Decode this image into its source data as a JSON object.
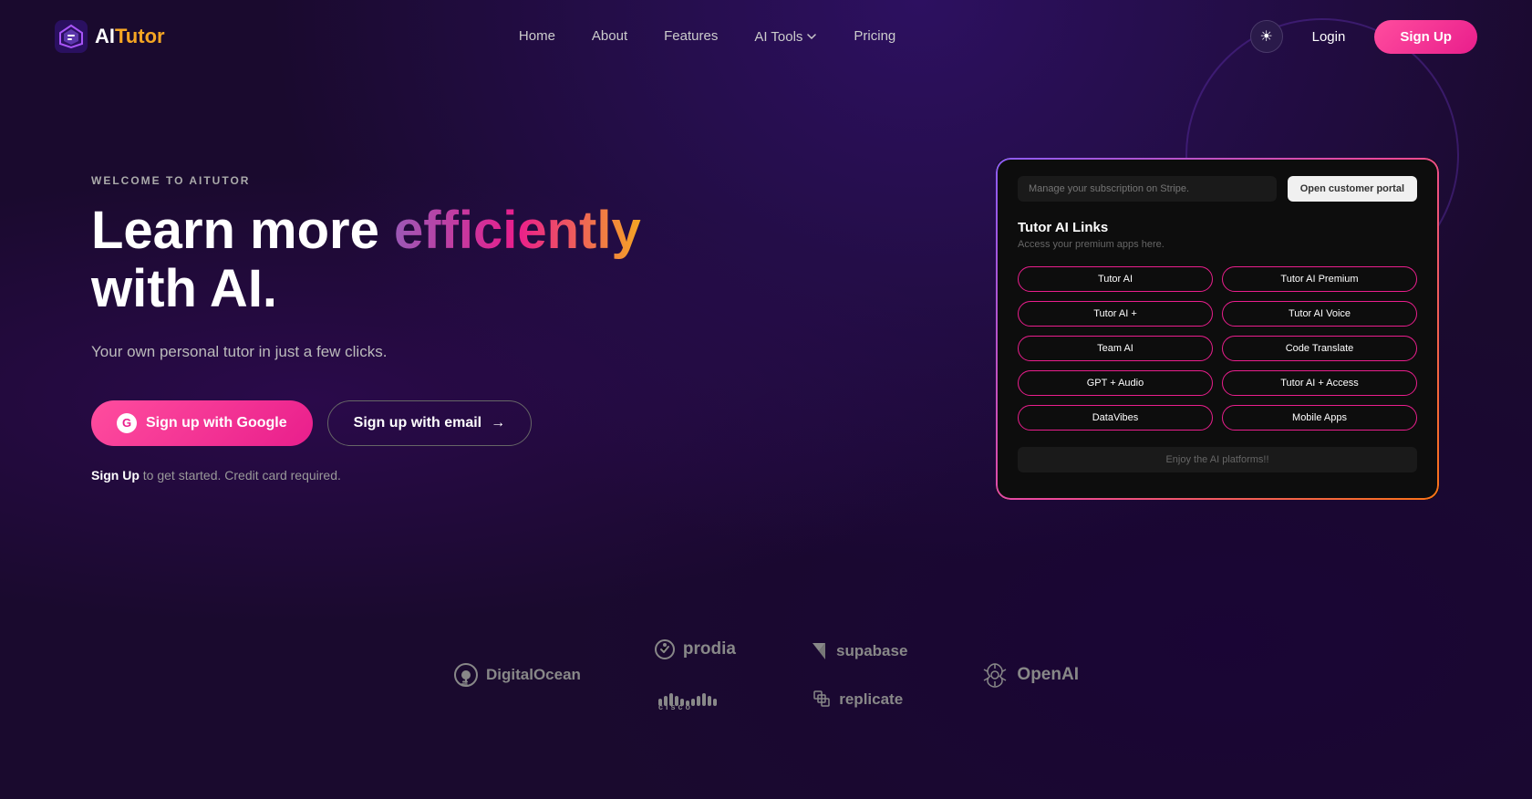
{
  "brand": {
    "logo_text_ai": "AI",
    "logo_text_tutor": "Tutor",
    "tagline": "WELCOME TO AITUTOR"
  },
  "nav": {
    "links": [
      {
        "label": "Home",
        "id": "home"
      },
      {
        "label": "About",
        "id": "about"
      },
      {
        "label": "Features",
        "id": "features"
      },
      {
        "label": "AI Tools",
        "id": "aitools",
        "has_dropdown": true
      },
      {
        "label": "Pricing",
        "id": "pricing"
      }
    ],
    "login_label": "Login",
    "signup_label": "Sign Up",
    "theme_icon": "☀"
  },
  "hero": {
    "tagline": "WELCOME TO AITUTOR",
    "title_before": "Learn more ",
    "title_gradient": "efficiently",
    "title_after": " with AI.",
    "subtitle": "Your own personal tutor in just a few clicks.",
    "btn_google": "Sign up with Google",
    "btn_email": "Sign up with email",
    "note_highlight": "Sign Up",
    "note_text": " to get started. Credit card required.",
    "arrow": "→"
  },
  "preview": {
    "input_placeholder": "Manage your subscription on Stripe.",
    "portal_btn": "Open customer portal",
    "section_title": "Tutor AI Links",
    "section_sub": "Access your premium apps here.",
    "links": [
      "Tutor AI",
      "Tutor AI Premium",
      "Tutor AI +",
      "Tutor AI Voice",
      "Team AI",
      "Code Translate",
      "GPT + Audio",
      "Tutor AI + Access",
      "DataVibes",
      "Mobile Apps"
    ],
    "footer_text": "Enjoy the AI platforms!!"
  },
  "brands": [
    {
      "name": "DigitalOcean",
      "type": "single"
    },
    {
      "name": "prodia",
      "type": "col"
    },
    {
      "name": "cisco",
      "type": "col"
    },
    {
      "name": "supabase",
      "type": "col"
    },
    {
      "name": "replicate",
      "type": "col"
    },
    {
      "name": "OpenAI",
      "type": "single"
    }
  ]
}
